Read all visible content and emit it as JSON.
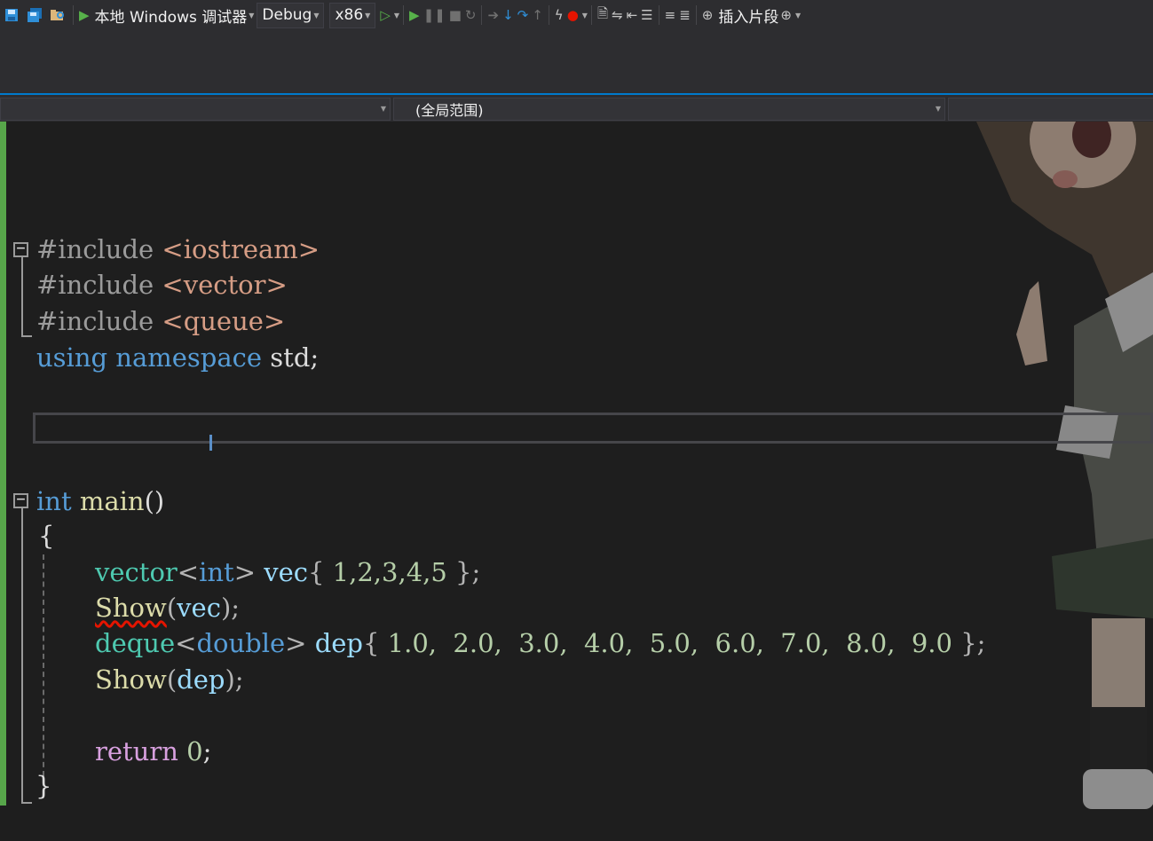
{
  "toolbar": {
    "debugger_label": "本地 Windows 调试器",
    "configuration": "Debug",
    "platform": "x86",
    "insert_snippet_label": "插入片段"
  },
  "navbar": {
    "scope_combo": "(全局范围)"
  },
  "code": {
    "l1_directive": "#include",
    "l1_header": "<iostream>",
    "l2_directive": "#include",
    "l2_header": "<vector>",
    "l3_directive": "#include",
    "l3_header": "<queue>",
    "l4_using": "using",
    "l4_namespace": "namespace",
    "l4_rest": " std;",
    "l6_int": "int",
    "l6_main": "main",
    "l6_paren": "()",
    "l7_brace": "{",
    "l8_vector": "vector",
    "l8_lt": "<",
    "l8_int": "int",
    "l8_gt": ">",
    "l8_vec": "vec",
    "l8_open": "{",
    "l8_nums": " 1,2,3,4,5 ",
    "l8_close": "};",
    "l9_show": "Show",
    "l9_open": "(",
    "l9_arg": "vec",
    "l9_close": ");",
    "l10_deque": "deque",
    "l10_lt": "<",
    "l10_double": "double",
    "l10_gt": ">",
    "l10_dep": "dep",
    "l10_open": "{",
    "l10_nums": " 1.0,  2.0,  3.0,  4.0,  5.0,  6.0,  7.0,  8.0,  9.0 ",
    "l10_close": "};",
    "l11_show": "Show",
    "l11_open": "(",
    "l11_arg": "dep",
    "l11_close": ");",
    "l13_return": "return",
    "l13_zero": "0",
    "l13_semi": ";",
    "l14_brace": "}"
  },
  "colors": {
    "accent": "#007acc",
    "margin_changed": "#57a64a",
    "keyword": "#569cd6",
    "type": "#4ec9b0",
    "function": "#dcdcaa",
    "number": "#b5cea8",
    "control": "#d8a0df"
  }
}
